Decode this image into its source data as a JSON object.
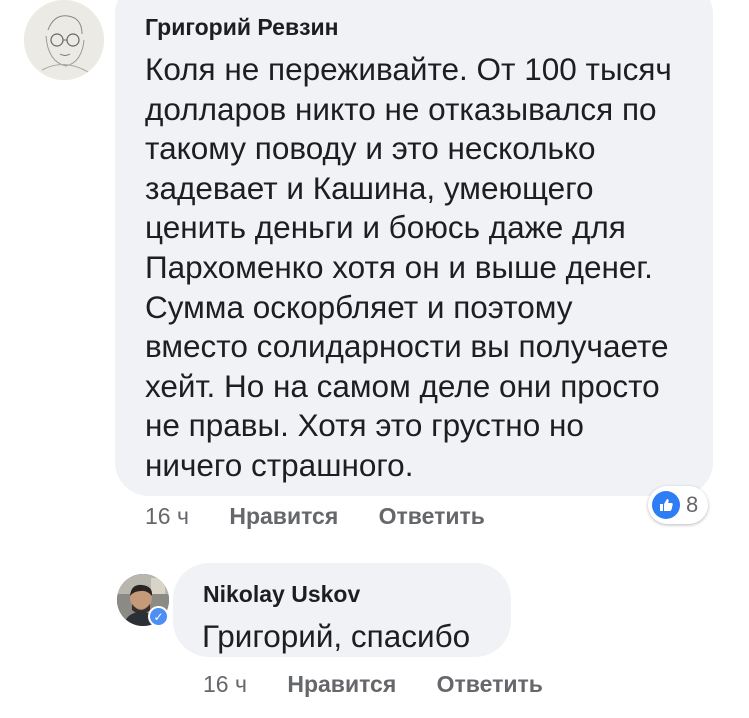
{
  "comment": {
    "author": "Григорий Ревзин",
    "lines": [
      "Коля не переживайте. От 100 тысяч",
      "долларов никто не отказывался по",
      "такому поводу и это несколько",
      "задевает и Кашина, умеющего",
      "ценить деньги и боюсь даже для",
      "Пархоменко хотя он и выше денег.",
      "Сумма оскорбляет и поэтому",
      "вместо солидарности вы получаете",
      "хейт. Но на самом деле они просто",
      "не правы. Хотя это грустно но",
      "ничего страшного."
    ],
    "time": "16 ч",
    "like_label": "Нравится",
    "reply_label": "Ответить",
    "reaction_count": "8",
    "reaction_icon": "thumbs-up-icon"
  },
  "reply": {
    "author": "Nikolay Uskov",
    "text": "Григорий, спасибо",
    "time": "16 ч",
    "like_label": "Нравится",
    "reply_label": "Ответить",
    "badge_icon": "verified-check-icon"
  },
  "colors": {
    "bubble": "#f0f2f5",
    "text": "#1c1e21",
    "meta": "#65676b",
    "like_blue": "#2f7df5",
    "verified_blue": "#4e8ff4"
  }
}
